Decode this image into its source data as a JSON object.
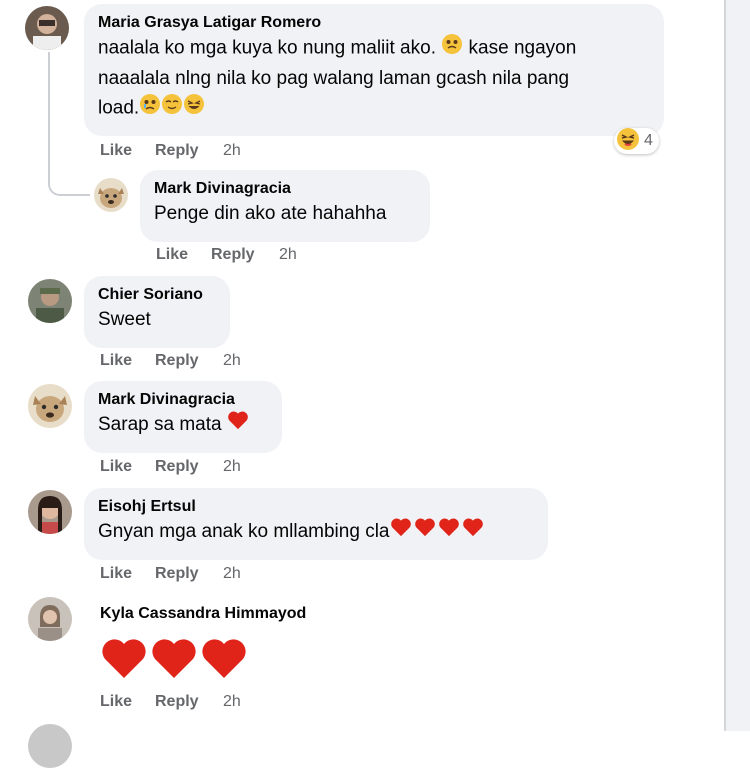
{
  "comments": [
    {
      "author": "Maria Grasya Latigar Romero",
      "line1_a": "naalala ko mga kuya ko nung maliit ako.",
      "line1_b": "kase ngayon",
      "line2": "naaalala nlng nila ko pag walang laman gcash nila pang",
      "line3": "load.",
      "reaction_count": "4",
      "like": "Like",
      "reply": "Reply",
      "time": "2h"
    },
    {
      "author": "Mark Divinagracia",
      "text": "Penge din ako ate hahahha",
      "like": "Like",
      "reply": "Reply",
      "time": "2h"
    },
    {
      "author": "Chier Soriano",
      "text": "Sweet",
      "like": "Like",
      "reply": "Reply",
      "time": "2h"
    },
    {
      "author": "Mark Divinagracia",
      "text": "Sarap sa mata",
      "like": "Like",
      "reply": "Reply",
      "time": "2h"
    },
    {
      "author": "Eisohj Ertsul",
      "text": "Gnyan mga anak ko mllambing cla",
      "like": "Like",
      "reply": "Reply",
      "time": "2h"
    },
    {
      "author": "Kyla Cassandra Himmayod",
      "like": "Like",
      "reply": "Reply",
      "time": "2h"
    }
  ],
  "colors": {
    "bubble": "#f0f2f5",
    "muted": "#65676b",
    "heart": "#e0241a",
    "emoji": "#f5c33b"
  }
}
